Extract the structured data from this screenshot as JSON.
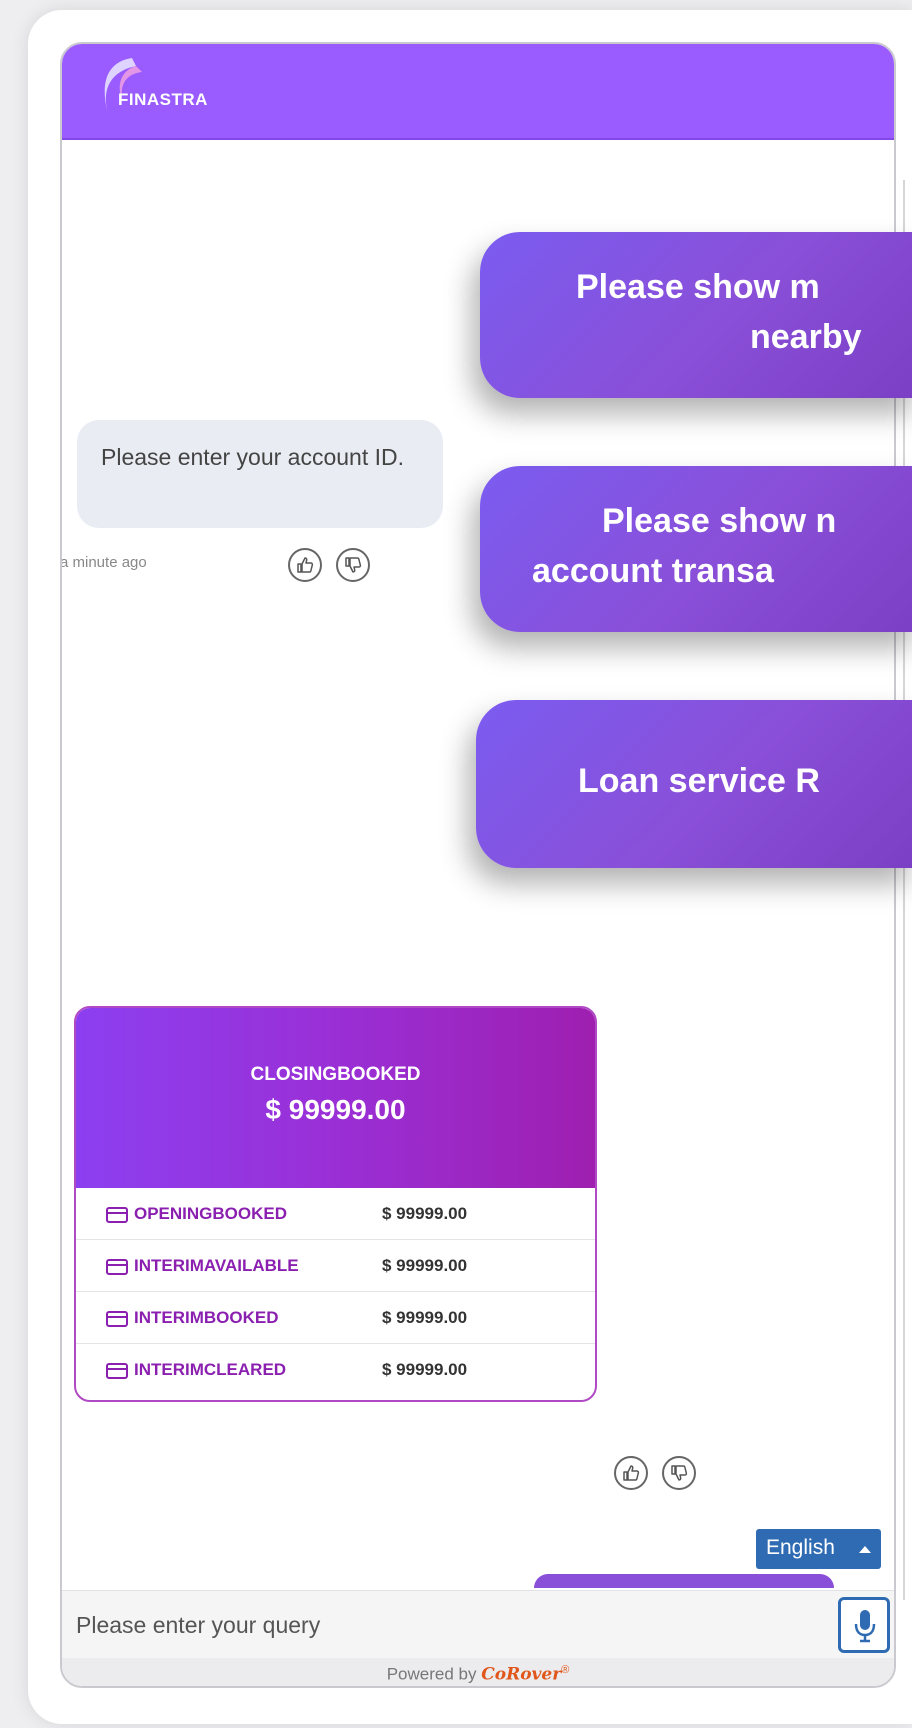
{
  "header": {
    "logo_text": "FINASTRA"
  },
  "chips": [
    {
      "line1": "Please show m",
      "line2": "nearby"
    },
    {
      "line1": "Please show n",
      "line2": "account transa"
    },
    {
      "line1": "Loan service R"
    }
  ],
  "bot_message": {
    "text": "Please enter your account ID.",
    "time": "a minute ago"
  },
  "balance_card": {
    "title": "CLOSINGBOOKED",
    "amount": "$ 99999.00",
    "rows": [
      {
        "label": "OPENINGBOOKED",
        "value": "$ 99999.00"
      },
      {
        "label": "INTERIMAVAILABLE",
        "value": "$ 99999.00"
      },
      {
        "label": "INTERIMBOOKED",
        "value": "$ 99999.00"
      },
      {
        "label": "INTERIMCLEARED",
        "value": "$ 99999.00"
      }
    ]
  },
  "language": {
    "label": "English"
  },
  "input": {
    "placeholder": "Please enter your query"
  },
  "footer": {
    "powered_by": "Powered by",
    "brand": "CoRover",
    "registered": "®"
  },
  "colors": {
    "header": "#9a5cff",
    "chip": "#8a4fd8",
    "card_accent": "#8a1fb0",
    "language_button": "#2f6bb3",
    "brand": "#e0561b"
  }
}
